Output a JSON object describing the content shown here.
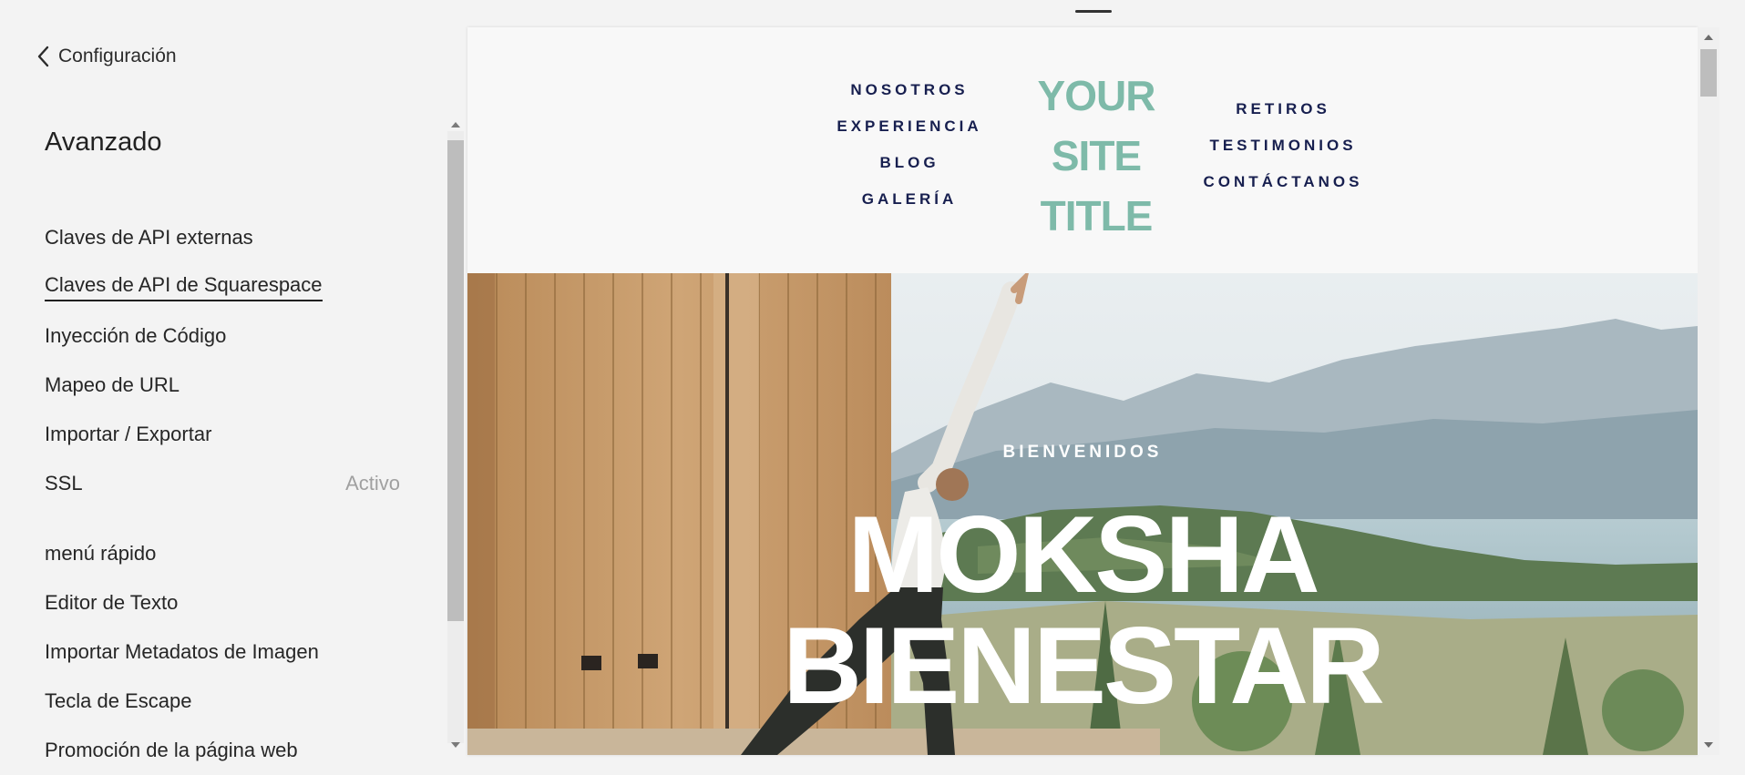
{
  "panel": {
    "back_label": "Configuración",
    "title": "Avanzado",
    "items": [
      {
        "label": "Claves de API externas"
      },
      {
        "label": "Claves de API de Squarespace"
      },
      {
        "label": "Inyección de Código"
      },
      {
        "label": "Mapeo de URL"
      },
      {
        "label": "Importar / Exportar"
      },
      {
        "label": "SSL",
        "status": "Activo"
      }
    ],
    "items2": [
      {
        "label": "menú rápido"
      },
      {
        "label": "Editor de Texto"
      },
      {
        "label": "Importar Metadatos de Imagen"
      },
      {
        "label": "Tecla de Escape"
      },
      {
        "label": "Promoción de la página web"
      }
    ]
  },
  "site": {
    "nav_left": [
      "NOSOTROS",
      "EXPERIENCIA",
      "BLOG",
      "GALERÍA"
    ],
    "title_lines": [
      "YOUR",
      "SITE",
      "TITLE"
    ],
    "nav_right": [
      "RETIROS",
      "TESTIMONIOS",
      "CONTÁCTANOS"
    ],
    "hero": {
      "welcome": "BIENVENIDOS",
      "title_lines": [
        "MOKSHA",
        "BIENESTAR"
      ]
    }
  },
  "colors": {
    "site_title": "#7ebaa9",
    "site_nav": "#171f4f",
    "ssl_status": "#a0a0a0"
  },
  "icons": {
    "back": "chevron-left-icon"
  }
}
